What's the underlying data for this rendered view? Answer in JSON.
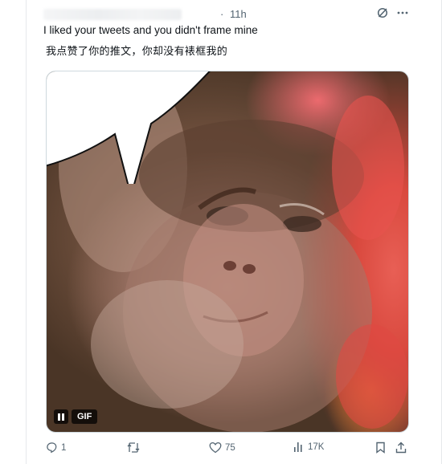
{
  "tweet": {
    "timestamp": "11h",
    "dot": "·",
    "text_line1": "I liked your tweets and you didn't frame mine",
    "text_line2": "我点赞了你的推文，你却没有裱框我的"
  },
  "media": {
    "gif_label": "GIF"
  },
  "stats": {
    "replies": "1",
    "reposts": "",
    "likes": "75",
    "views": "17K"
  },
  "icons": {
    "grok": "grok-icon",
    "more": "more-icon",
    "reply": "reply-icon",
    "repost": "repost-icon",
    "like": "heart-icon",
    "views": "views-icon",
    "bookmark": "bookmark-icon",
    "share": "share-icon",
    "pause": "pause-icon"
  },
  "colors": {
    "text": "#0f1419",
    "muted": "#536471",
    "border": "#cfd9de"
  }
}
